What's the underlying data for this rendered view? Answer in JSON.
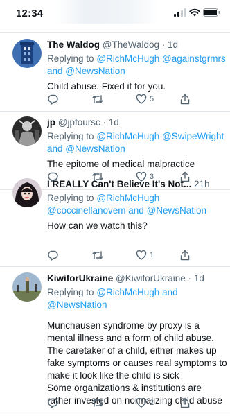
{
  "status_bar": {
    "time": "12:34"
  },
  "tweets": [
    {
      "name": "The Waldog",
      "handle": "@TheWaldog",
      "time": "1d",
      "replying_prefix": "Replying to",
      "replying_users": "@RichMcHugh @againstgrmrs",
      "replying_and": "and",
      "replying_last": "@NewsNation",
      "text": "Child abuse. Fixed it for you.",
      "likes": "5"
    },
    {
      "name": "jp",
      "handle": "@jpfoursc",
      "time": "1d",
      "replying_prefix": "Replying to",
      "replying_users": "@RichMcHugh @SwipeWright",
      "replying_and": "and",
      "replying_last": "@NewsNation",
      "text": "The epitome of medical malpractice",
      "likes": "3"
    },
    {
      "name": "I REALLY Can't Believe It's Not...",
      "handle": "",
      "time": "21h",
      "replying_prefix": "Replying to",
      "replying_users": "@RichMcHugh",
      "replying_line2": "@coccinellanovem",
      "replying_and": "and",
      "replying_last": "@NewsNation",
      "text": "How can we watch this?",
      "likes": "1"
    },
    {
      "name": "KiwiforUkraine",
      "handle": "@KiwiforUkraine",
      "time": "1d",
      "replying_prefix": "Replying to",
      "replying_users": "@RichMcHugh",
      "replying_and": "and",
      "replying_last": "@NewsNation",
      "text_lines": [
        "Munchausen syndrome by proxy is a",
        "mental illness and a form of child abuse.",
        "The caretaker of a child, either makes up",
        "fake symptoms or causes real symptoms to",
        "make it look like the child is sick",
        "Some organizations & institutions are",
        "rather invested on normalizing child abuse"
      ],
      "likes": "2"
    }
  ],
  "icons": [
    "reply-icon",
    "retweet-icon",
    "like-icon",
    "share-icon"
  ],
  "colors": {
    "link": "#1d9bf0",
    "secondary": "#536471",
    "primary": "#0f1419",
    "divider": "#e1e6ea"
  }
}
